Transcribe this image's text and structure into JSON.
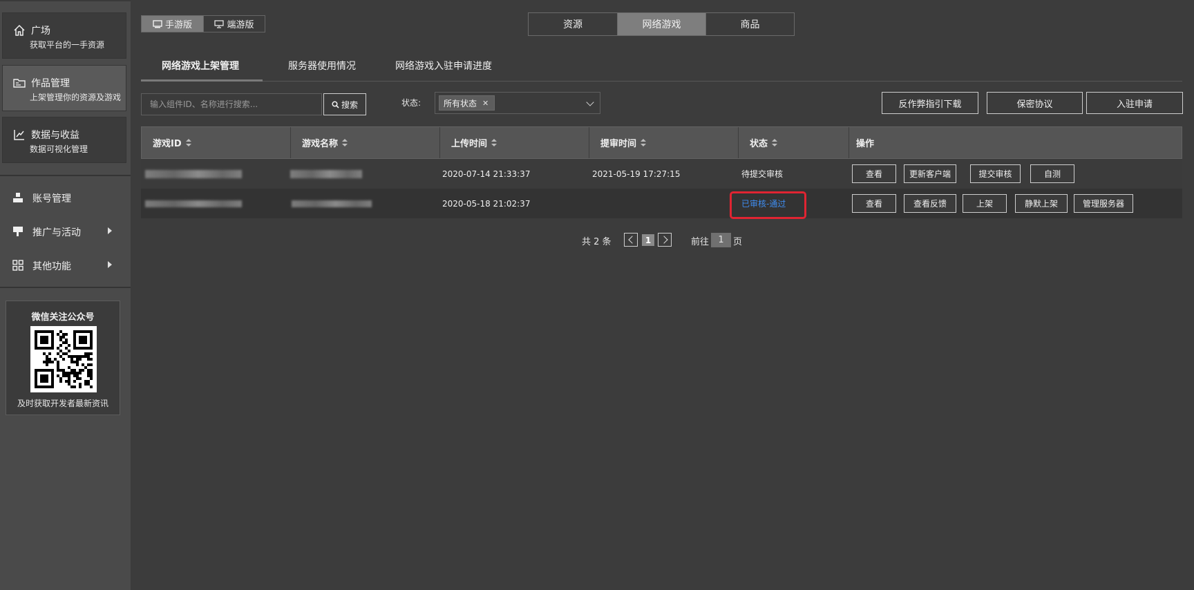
{
  "sidebar": {
    "cards": [
      {
        "title": "广场",
        "subtitle": "获取平台的一手资源",
        "icon": "home-icon"
      },
      {
        "title": "作品管理",
        "subtitle": "上架管理你的资源及游戏",
        "icon": "folder-icon"
      },
      {
        "title": "数据与收益",
        "subtitle": "数据可视化管理",
        "icon": "chart-icon"
      }
    ],
    "nav": [
      {
        "label": "账号管理",
        "icon": "account-icon"
      },
      {
        "label": "推广与活动",
        "icon": "promo-icon"
      },
      {
        "label": "其他功能",
        "icon": "grid-icon"
      }
    ],
    "qr": {
      "title": "微信关注公众号",
      "caption": "及时获取开发者最新资讯"
    }
  },
  "version_toggle": {
    "mobile": "手游版",
    "pc": "端游版",
    "active": "mobile"
  },
  "top_tabs": [
    "资源",
    "网络游戏",
    "商品"
  ],
  "sub_tabs": [
    "网络游戏上架管理",
    "服务器使用情况",
    "网络游戏入驻申请进度"
  ],
  "search": {
    "placeholder": "输入组件ID、名称进行搜索...",
    "button": "搜索"
  },
  "filter": {
    "label": "状态:",
    "tag": "所有状态"
  },
  "actions": [
    "反作弊指引下载",
    "保密协议",
    "入驻申请"
  ],
  "table": {
    "columns": [
      "游戏ID",
      "游戏名称",
      "上传时间",
      "提审时间",
      "状态",
      "操作"
    ],
    "rows": [
      {
        "upload_time": "2020-07-14 21:33:37",
        "review_time": "2021-05-19 17:27:15",
        "status": "待提交审核",
        "ops": [
          "查看",
          "更新客户端",
          "提交审核",
          "自测"
        ]
      },
      {
        "upload_time": "2020-05-18 21:02:37",
        "review_time": "",
        "status": "已审核-通过",
        "ops": [
          "查看",
          "查看反馈",
          "上架",
          "静默上架",
          "管理服务器"
        ]
      }
    ]
  },
  "pagination": {
    "total": "共 2 条",
    "current": "1",
    "goto_label": "前往",
    "goto_value": "1",
    "page_suffix": "页"
  },
  "colors": {
    "accent_blue": "#3f8df0",
    "highlight_red": "#e02432"
  }
}
